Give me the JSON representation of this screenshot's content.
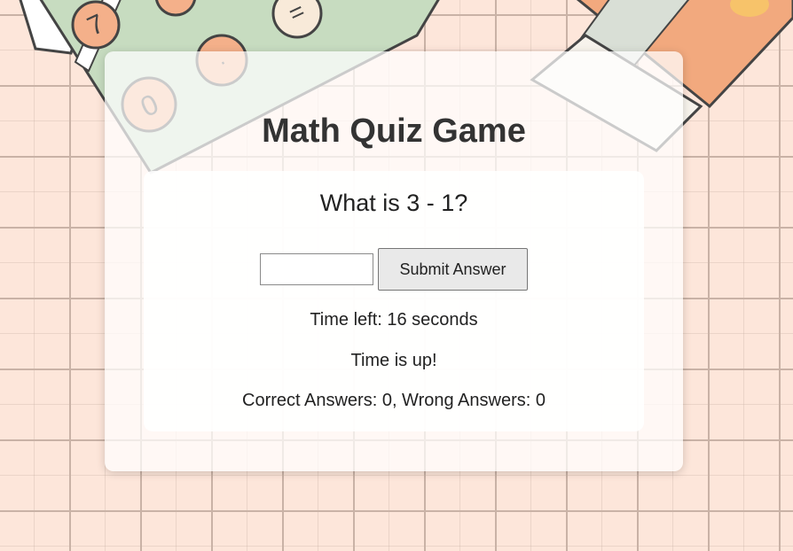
{
  "game": {
    "title": "Math Quiz Game",
    "question": "What is 3 - 1?",
    "answer_value": "",
    "submit_label": "Submit Answer",
    "timer_text": "Time left: 16 seconds",
    "message_text": "Time is up!",
    "score_text": "Correct Answers: 0, Wrong Answers: 0"
  },
  "colors": {
    "background": "#fde6da",
    "grid": "#c9b2a6",
    "calculator": "#c7dcc0",
    "book": "#f2a97e"
  },
  "background_icons": [
    "calculator-icon",
    "notebook-icon"
  ]
}
